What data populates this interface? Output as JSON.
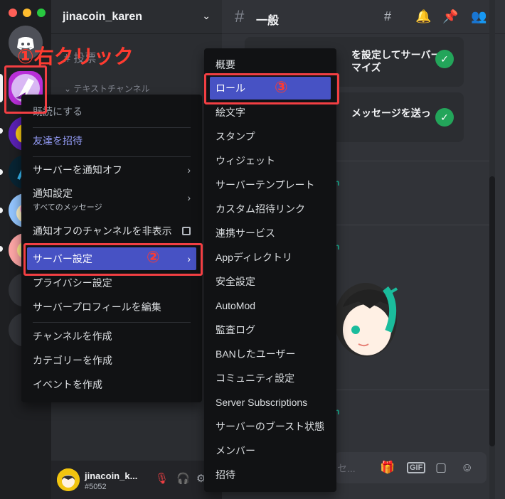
{
  "window": {
    "traffic_lights": [
      "#ff5f57",
      "#febc2e",
      "#28c840"
    ]
  },
  "server": {
    "name": "jinacoin_karen"
  },
  "sidebar": {
    "ghost_channel": "# 投票",
    "ghost_category": "テキストチャンネル"
  },
  "channel": {
    "name": "一般"
  },
  "welcome_cards": [
    {
      "line1": "を設定してサーバー",
      "line2": "マイズ"
    },
    {
      "line1": "メッセージを送っ",
      "line2": ""
    }
  ],
  "annotations": {
    "step1": "①右クリック",
    "step2": "②",
    "step3": "③"
  },
  "server_menu": {
    "items": [
      {
        "label": "既読にする",
        "id": "mark-read"
      },
      {
        "label": "友達を招待",
        "id": "invite-friends"
      },
      {
        "label": "サーバーを通知オフ",
        "id": "mute-server"
      },
      {
        "label": "通知設定",
        "sub": "すべてのメッセージ",
        "id": "notification-settings"
      },
      {
        "label": "通知オフのチャンネルを非表示",
        "id": "hide-muted-channels"
      },
      {
        "label": "サーバー設定",
        "id": "server-settings"
      },
      {
        "label": "プライバシー設定",
        "id": "privacy-settings"
      },
      {
        "label": "サーバープロフィールを編集",
        "id": "edit-server-profile"
      },
      {
        "label": "チャンネルを作成",
        "id": "create-channel"
      },
      {
        "label": "カテゴリーを作成",
        "id": "create-category"
      },
      {
        "label": "イベントを作成",
        "id": "create-event"
      }
    ]
  },
  "settings_menu": {
    "items": [
      "概要",
      "ロール",
      "絵文字",
      "スタンプ",
      "ウィジェット",
      "サーバーテンプレート",
      "カスタム招待リンク",
      "連携サービス",
      "Appディレクトリ",
      "安全設定",
      "AutoMod",
      "監査ログ",
      "BANしたユーザー",
      "コミュニティ設定",
      "Server Subscriptions",
      "サーバーのブースト状態",
      "メンバー",
      "招待"
    ]
  },
  "user": {
    "name": "jinacoin_k...",
    "tag": "#5052"
  },
  "composer": {
    "placeholder": "セ..."
  },
  "colors": {
    "accent": "#4752c4",
    "highlight": "#f23f43",
    "online": "#23a55a",
    "teal": "#1abc9c"
  }
}
